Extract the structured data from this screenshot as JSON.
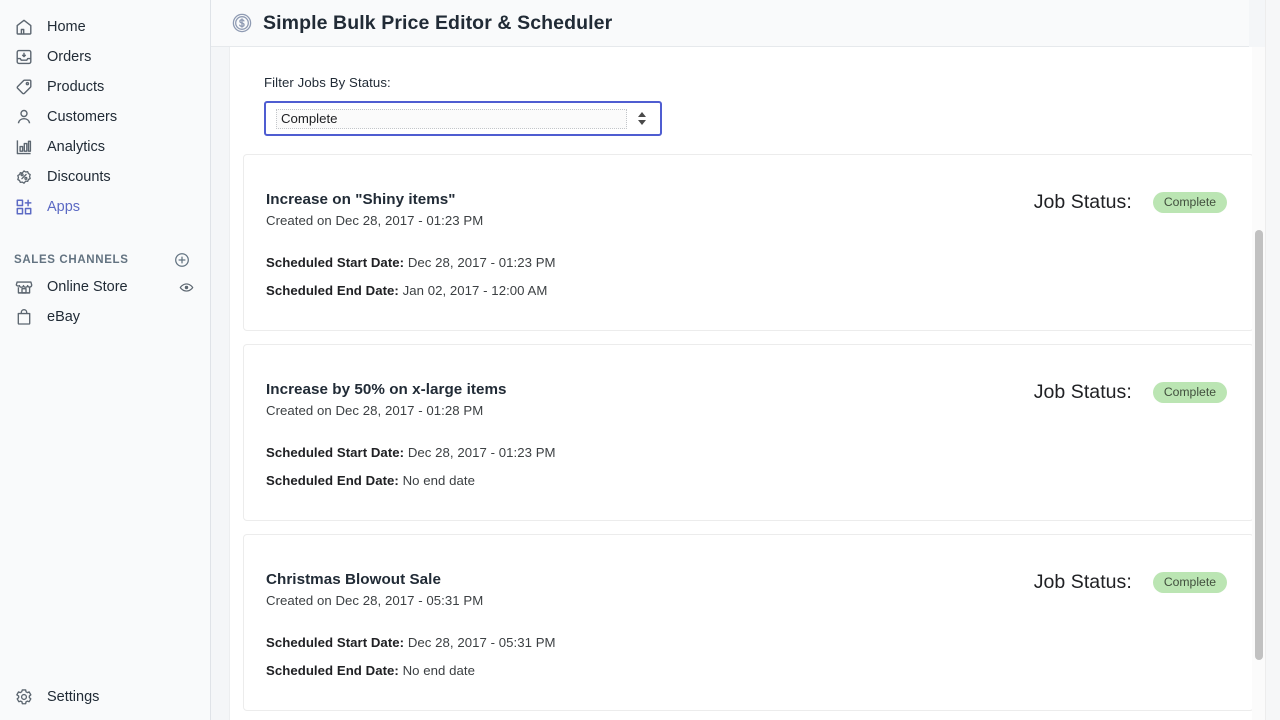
{
  "sidebar": {
    "items": [
      {
        "label": "Home",
        "icon": "home-icon",
        "active": false
      },
      {
        "label": "Orders",
        "icon": "orders-icon",
        "active": false
      },
      {
        "label": "Products",
        "icon": "products-tag-icon",
        "active": false
      },
      {
        "label": "Customers",
        "icon": "customers-person-icon",
        "active": false
      },
      {
        "label": "Analytics",
        "icon": "analytics-bar-chart-icon",
        "active": false
      },
      {
        "label": "Discounts",
        "icon": "discounts-percent-icon",
        "active": false
      },
      {
        "label": "Apps",
        "icon": "apps-grid-plus-icon",
        "active": true
      }
    ],
    "section": {
      "title": "SALES CHANNELS",
      "add_icon": "plus-circle-icon"
    },
    "channels": [
      {
        "label": "Online Store",
        "icon": "storefront-icon",
        "trailing_icon": "eye-preview-icon"
      },
      {
        "label": "eBay",
        "icon": "shopping-bag-icon",
        "trailing_icon": ""
      }
    ],
    "settings": {
      "label": "Settings",
      "icon": "gear-icon"
    },
    "active_color": "#5c6ac4"
  },
  "header": {
    "title": "Simple Bulk Price Editor & Scheduler",
    "logo_icon": "dollar-circle-icon"
  },
  "filter": {
    "label": "Filter Jobs By Status:",
    "selected": "Complete",
    "options": [
      "Complete"
    ],
    "spinner_icon": "updown-spinner-icon",
    "focus_color": "#4f5dd1"
  },
  "jobs_section": {
    "status_label": "Job Status:",
    "start_label": "Scheduled Start Date:",
    "end_label": "Scheduled End Date:",
    "created_prefix": "Created on",
    "badge_color": "#bbe5b3"
  },
  "jobs": [
    {
      "title": "Increase on \"Shiny items\"",
      "created": "Created on Dec 28, 2017 - 01:23 PM",
      "status": "Complete",
      "start_date": "Dec 28, 2017 - 01:23 PM",
      "end_date": "Jan 02, 2017 - 12:00 AM"
    },
    {
      "title": "Increase by 50% on x-large items",
      "created": "Created on Dec 28, 2017 - 01:28 PM",
      "status": "Complete",
      "start_date": "Dec 28, 2017 - 01:23 PM",
      "end_date": "No end date"
    },
    {
      "title": "Christmas Blowout Sale",
      "created": "Created on Dec 28, 2017 - 05:31 PM",
      "status": "Complete",
      "start_date": "Dec 28, 2017 - 05:31 PM",
      "end_date": "No end date"
    }
  ]
}
